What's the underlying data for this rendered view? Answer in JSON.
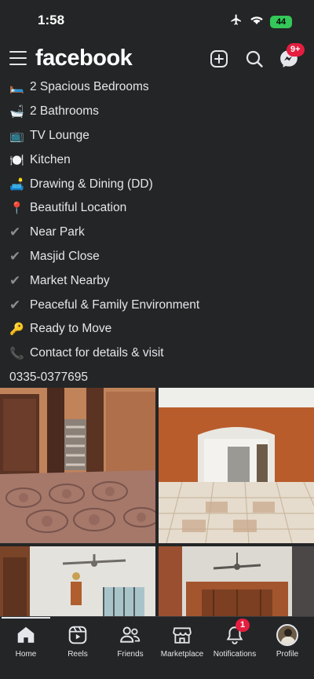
{
  "status_bar": {
    "time": "1:58",
    "battery": "44"
  },
  "header": {
    "logo": "facebook",
    "messenger_badge": "9+"
  },
  "post": {
    "lines": [
      {
        "icon": "bed-emoji",
        "glyph": "🛏️",
        "text": "2 Spacious Bedrooms"
      },
      {
        "icon": "bathtub-emoji",
        "glyph": "🛁",
        "text": "2 Bathrooms"
      },
      {
        "icon": "tv-emoji",
        "glyph": "📺",
        "text": "TV Lounge"
      },
      {
        "icon": "plate-emoji",
        "glyph": "🍽️",
        "text": "Kitchen"
      },
      {
        "icon": "couch-emoji",
        "glyph": "🛋️",
        "text": "Drawing & Dining (DD)"
      },
      {
        "icon": "pin-emoji",
        "glyph": "📍",
        "text": "Beautiful Location"
      },
      {
        "icon": "check-icon",
        "glyph": "✔",
        "text": "Near Park"
      },
      {
        "icon": "check-icon",
        "glyph": "✔",
        "text": "Masjid Close"
      },
      {
        "icon": "check-icon",
        "glyph": "✔",
        "text": "Market Nearby"
      },
      {
        "icon": "check-icon",
        "glyph": "✔",
        "text": "Peaceful & Family Environment"
      },
      {
        "icon": "key-emoji",
        "glyph": "🔑",
        "text": "Ready to Move"
      },
      {
        "icon": "phone-emoji",
        "glyph": "📞",
        "text": "Contact for details & visit"
      }
    ],
    "phone": "0335-0377695"
  },
  "tabbar": {
    "items": [
      {
        "label": "Home",
        "icon": "home-icon"
      },
      {
        "label": "Reels",
        "icon": "reels-icon"
      },
      {
        "label": "Friends",
        "icon": "friends-icon"
      },
      {
        "label": "Marketplace",
        "icon": "marketplace-icon"
      },
      {
        "label": "Notifications",
        "icon": "bell-icon",
        "badge": "1"
      },
      {
        "label": "Profile",
        "icon": "avatar"
      }
    ]
  },
  "colors": {
    "background": "#242526",
    "text": "#e4e6eb",
    "badge": "#e41e3f",
    "battery": "#34c759"
  }
}
